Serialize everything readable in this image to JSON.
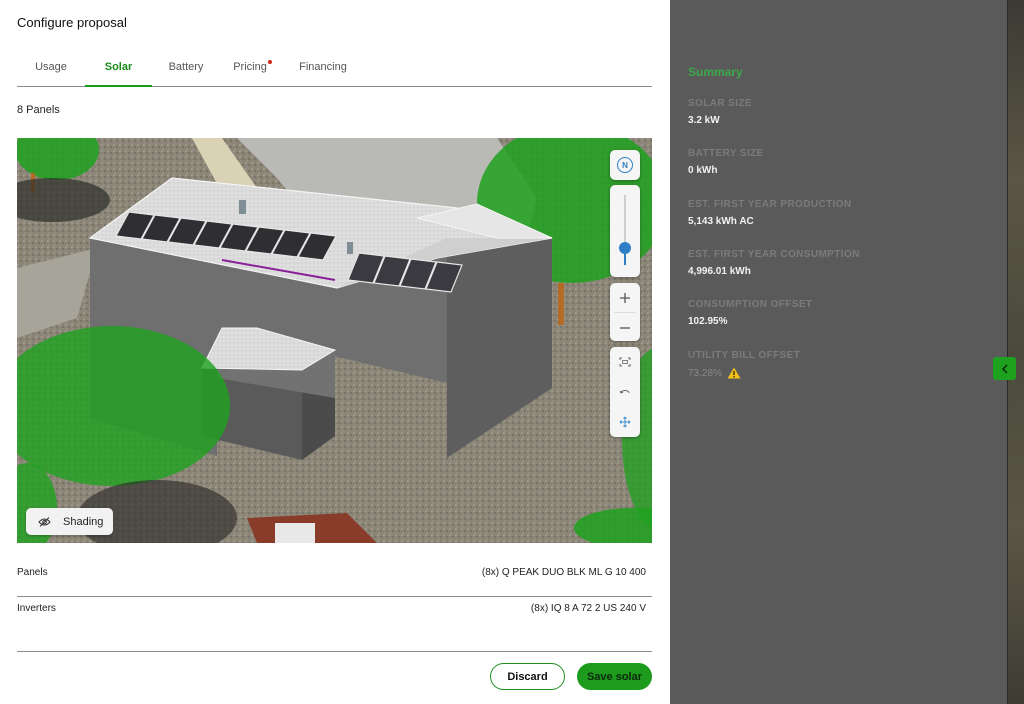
{
  "page": {
    "title": "Configure proposal"
  },
  "tabs": [
    {
      "label": "Usage",
      "active": false,
      "dot": false
    },
    {
      "label": "Solar",
      "active": true,
      "dot": false
    },
    {
      "label": "Battery",
      "active": false,
      "dot": false
    },
    {
      "label": "Pricing",
      "active": false,
      "dot": true
    },
    {
      "label": "Financing",
      "active": false,
      "dot": false
    }
  ],
  "solar": {
    "panel_count_label": "8 Panels",
    "shading_label": "Shading",
    "map_controls": {
      "compass_label": "N",
      "tilt_level": 0.75,
      "zoom_in_icon": "plus-icon",
      "zoom_out_icon": "minus-icon"
    },
    "specs": {
      "panels": {
        "label": "Panels",
        "value": "(8x) Q PEAK DUO BLK ML G 10 400"
      },
      "inverters": {
        "label": "Inverters",
        "value": "(8x) IQ 8 A 72 2 US 240 V"
      }
    },
    "actions": {
      "discard": "Discard",
      "save": "Save solar"
    }
  },
  "summary": {
    "title": "Summary",
    "items": [
      {
        "label": "SOLAR SIZE",
        "value": "3.2 kW"
      },
      {
        "label": "BATTERY SIZE",
        "value": "0 kWh"
      },
      {
        "label": "EST. FIRST YEAR PRODUCTION",
        "value": "5,143 kWh AC"
      },
      {
        "label": "EST. FIRST YEAR CONSUMPTION",
        "value": "4,996.01 kWh"
      },
      {
        "label": "CONSUMPTION OFFSET",
        "value": "102.95%"
      },
      {
        "label": "UTILITY BILL OFFSET",
        "value": "73.28%",
        "warning": true
      }
    ]
  },
  "colors": {
    "accent": "#1d9b1d",
    "summary_title": "#3ca84a",
    "warning": "#f2c21b",
    "pricing_dot": "#d4281e"
  },
  "icons": {
    "compass": "compass-icon",
    "shading": "eye-off-icon",
    "warning": "warning-icon",
    "collapse": "chevron-left-icon"
  }
}
